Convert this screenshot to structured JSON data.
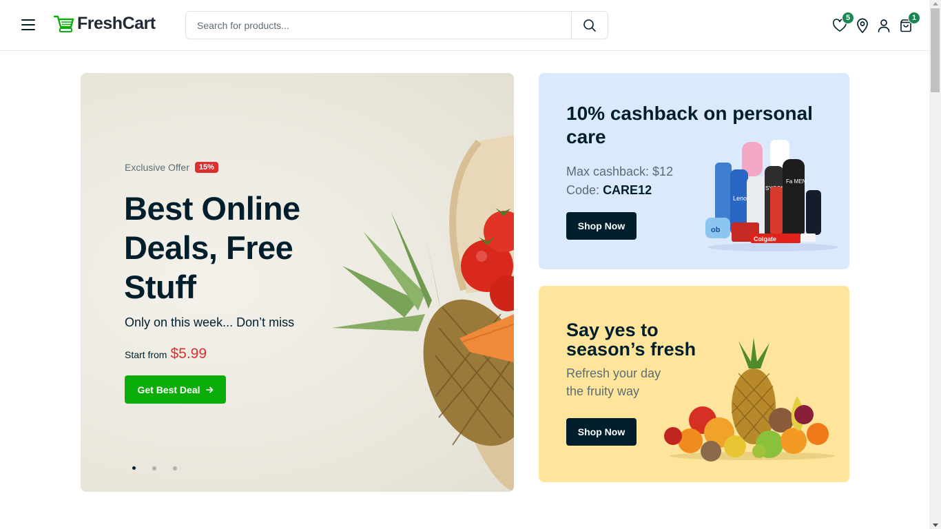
{
  "header": {
    "brand": "FreshCart",
    "search_placeholder": "Search for products...",
    "wishlist_count": "5",
    "cart_count": "1",
    "icons": [
      "menu-icon",
      "cart-logo-icon",
      "search-icon",
      "heart-icon",
      "location-icon",
      "user-icon",
      "bag-icon"
    ]
  },
  "hero": {
    "offer_label": "Exclusive Offer",
    "discount": "15%",
    "title": "Best Online Deals, Free Stuff",
    "subtitle": "Only on this week... Don’t miss",
    "price_label": "Start from",
    "price": "$5.99",
    "cta": "Get Best Deal",
    "cta_icon": "arrow-right-icon",
    "slides": 3,
    "active_slide": 1
  },
  "promo_personal_care": {
    "title": "10% cashback on personal care",
    "line1": "Max cashback: $12",
    "code_label": "Code:",
    "code": "CARE12",
    "cta": "Shop Now",
    "product_labels": [
      "Lenor",
      "Colgate",
      "SYOSS",
      "Fa MEN",
      "ob"
    ]
  },
  "promo_fruits": {
    "title": "Say yes to season’s fresh",
    "line1": "Refresh your day",
    "line2": "the fruity way",
    "cta": "Shop Now"
  },
  "colors": {
    "brand_green": "#0aad0a",
    "dark": "#001e2b",
    "sale_red": "#db3030",
    "card_blue": "#dbe9fd",
    "card_yellow": "#fee59b"
  }
}
